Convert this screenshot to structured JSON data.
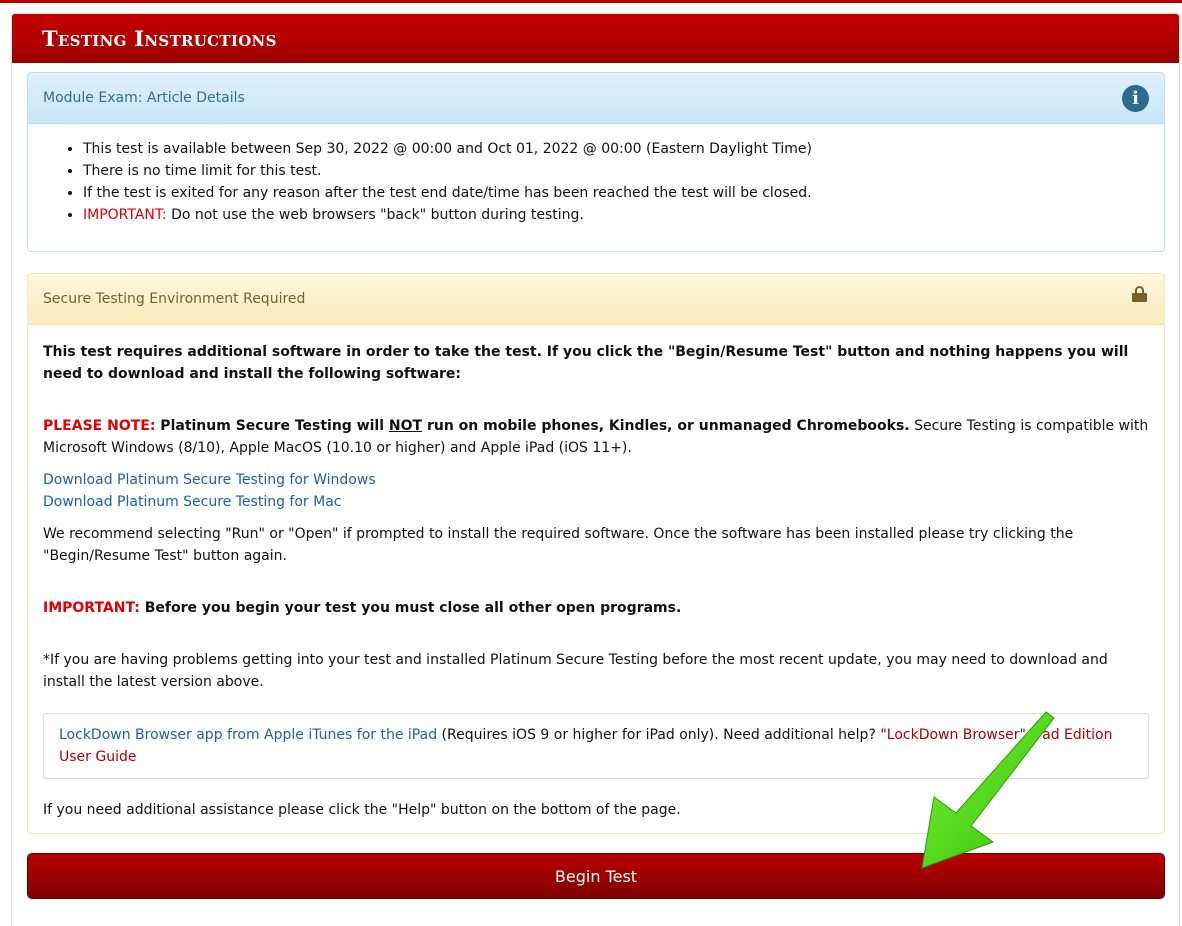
{
  "header": {
    "title": "Testing Instructions"
  },
  "details_panel": {
    "title": "Module Exam: Article Details",
    "icon": "info-icon",
    "items": [
      "This test is available between Sep 30, 2022 @ 00:00 and Oct 01, 2022 @ 00:00 (Eastern Daylight Time)",
      "There is no time limit for this test.",
      "If the test is exited for any reason after the test end date/time has been reached the test will be closed."
    ],
    "important_label": "IMPORTANT:",
    "important_text": " Do not use the web browsers \"back\" button during testing."
  },
  "secure_panel": {
    "title": "Secure Testing Environment Required",
    "icon": "lock-icon",
    "intro": "This test requires additional software in order to take the test. If you click the \"Begin/Resume Test\" button and nothing happens you will need to download and install the following software:",
    "note_label": "PLEASE NOTE:",
    "note_bold_1": " Platinum Secure Testing will ",
    "note_not": "NOT",
    "note_bold_2": " run on mobile phones, Kindles, or unmanaged Chromebooks.",
    "note_rest": " Secure Testing is compatible with Microsoft Windows (8/10), Apple MacOS (10.10 or higher) and Apple iPad (iOS 11+).",
    "download_windows": "Download Platinum Secure Testing for Windows",
    "download_mac": "Download Platinum Secure Testing for Mac",
    "recommend": "We recommend selecting \"Run\" or \"Open\" if prompted to install the required software. Once the software has been installed please try clicking the \"Begin/Resume Test\" button again.",
    "important_label": "IMPORTANT:",
    "important_text": " Before you begin your test you must close all other open programs.",
    "problems": "*If you are having problems getting into your test and installed Platinum Secure Testing before the most recent update, you may need to download and install the latest version above.",
    "ipad_link": "LockDown Browser app from Apple iTunes for the iPad",
    "ipad_text": " (Requires iOS 9 or higher for iPad only). Need additional help? ",
    "ipad_guide": "\"LockDown Browser\" iPad Edition User Guide",
    "help_text": "If you need additional assistance please click the \"Help\" button on the bottom of the page."
  },
  "begin_button": {
    "label": "Begin Test"
  },
  "annotation": {
    "arrow_color": "#44dd00",
    "icon": "arrow-icon"
  }
}
